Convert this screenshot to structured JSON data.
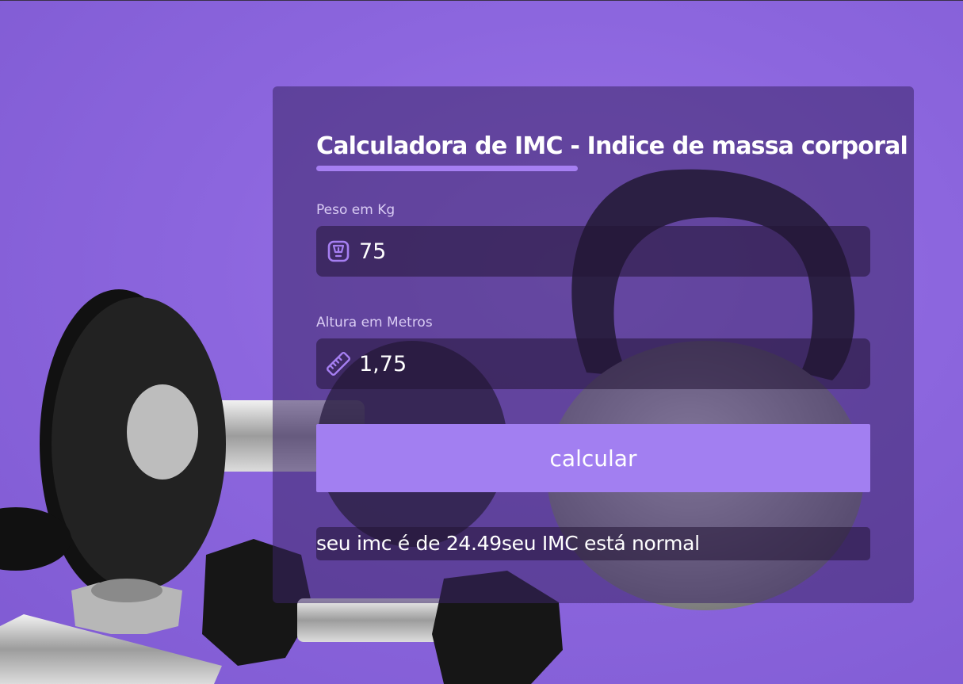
{
  "calculator": {
    "title": "Calculadora de IMC - Indice de massa corporal",
    "weight": {
      "label": "Peso em Kg",
      "value": "75",
      "icon": "scale-icon"
    },
    "height": {
      "label": "Altura em Metros",
      "value": "1,75",
      "icon": "ruler-icon"
    },
    "button_label": "calcular",
    "result_text": "seu imc é de 24.49seu IMC está normal"
  },
  "colors": {
    "background": "#8c66de",
    "accent": "#a27ff1",
    "card": "#3a2466",
    "text": "#ffffff"
  }
}
